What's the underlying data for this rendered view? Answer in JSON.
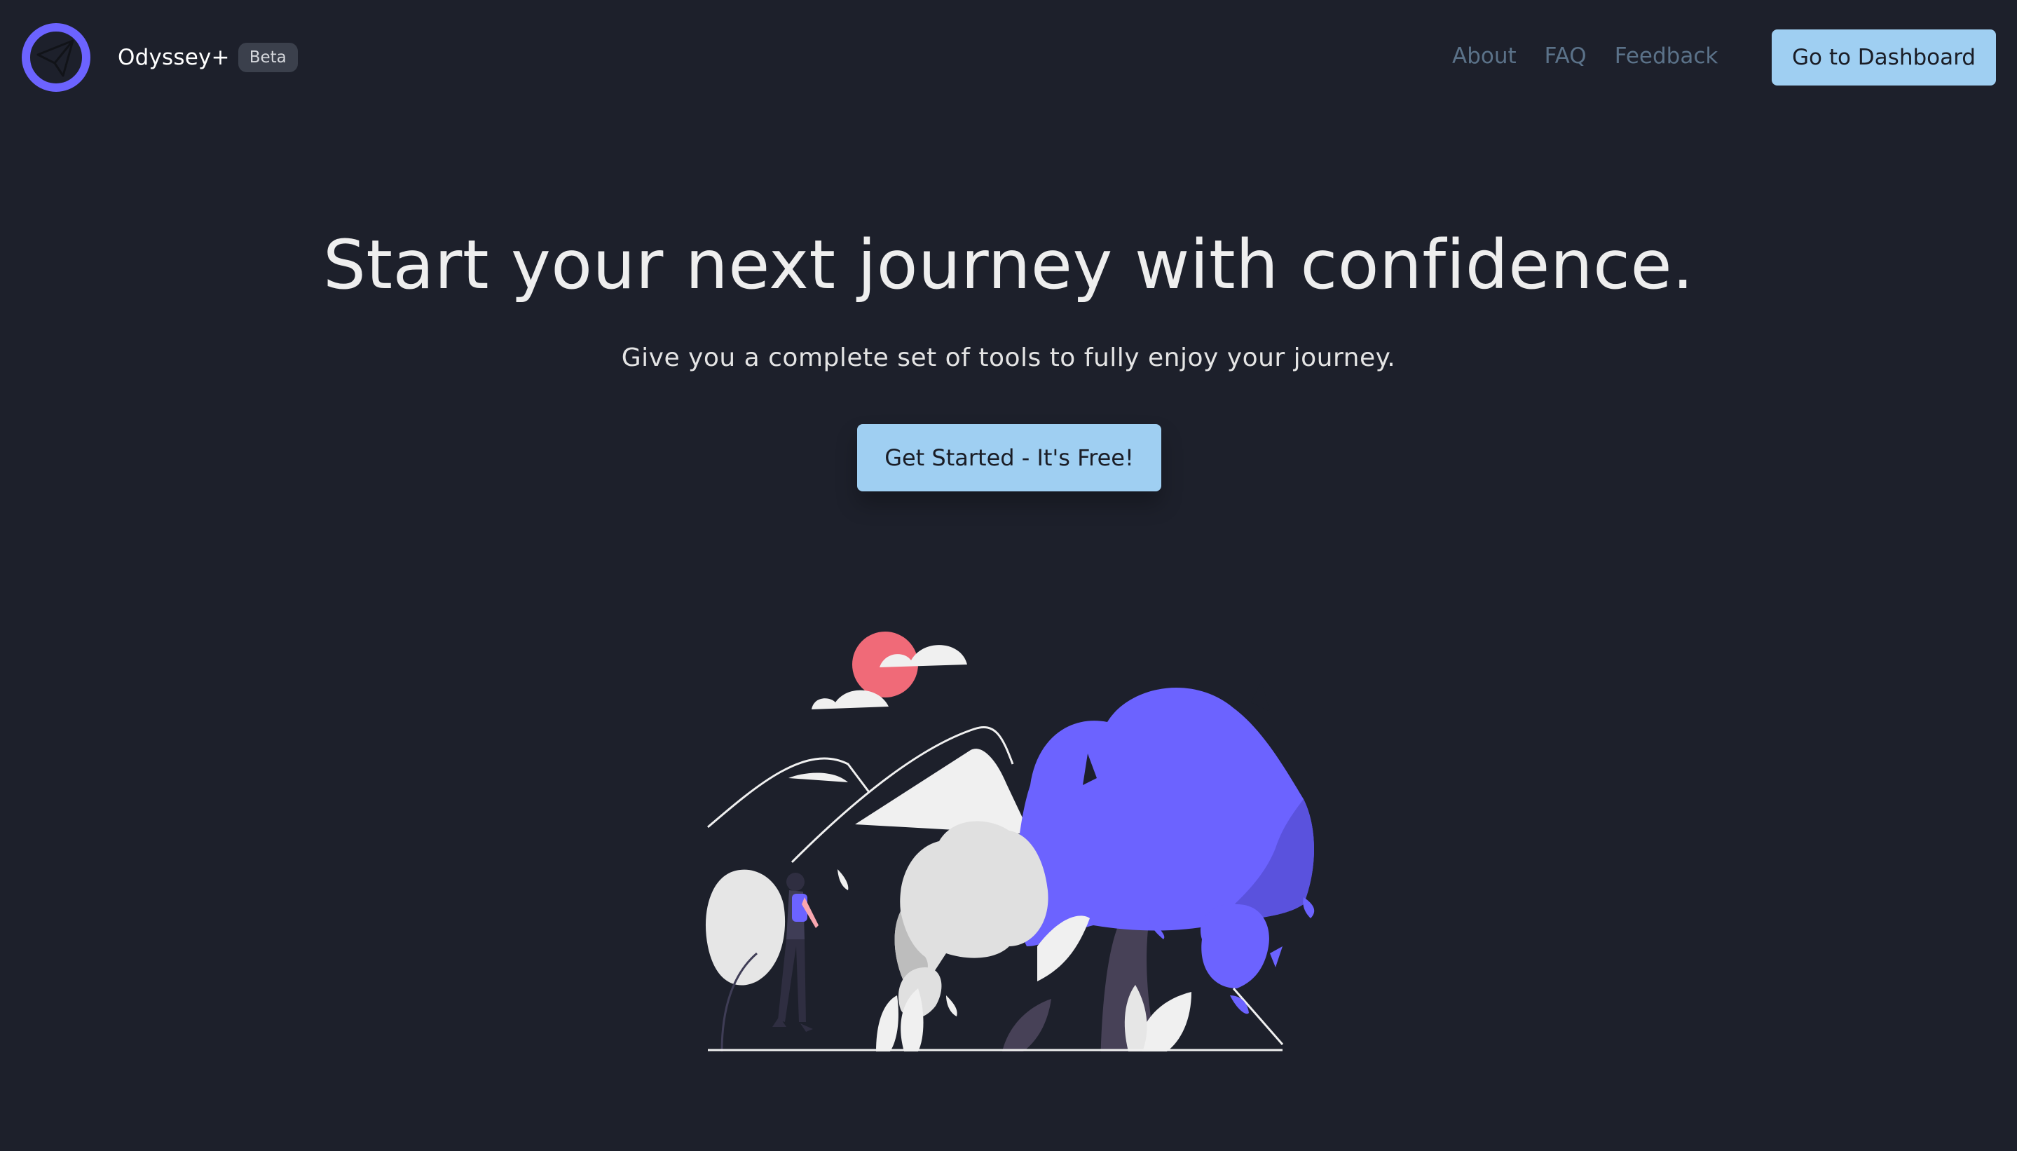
{
  "header": {
    "brand_name": "Odyssey+",
    "badge": "Beta",
    "nav": [
      {
        "label": "About"
      },
      {
        "label": "FAQ"
      },
      {
        "label": "Feedback"
      }
    ],
    "dashboard_button": "Go to Dashboard",
    "logo_icon": "paper-plane-icon"
  },
  "hero": {
    "title": "Start your next journey with confidence.",
    "subtitle": "Give you a complete set of tools to fully enjoy your journey.",
    "cta_label": "Get Started - It's Free!"
  },
  "colors": {
    "background": "#1d202b",
    "accent_button": "#9fcff2",
    "brand_purple": "#6c63ff",
    "nav_link": "#5b7289",
    "sun": "#f06a78"
  }
}
